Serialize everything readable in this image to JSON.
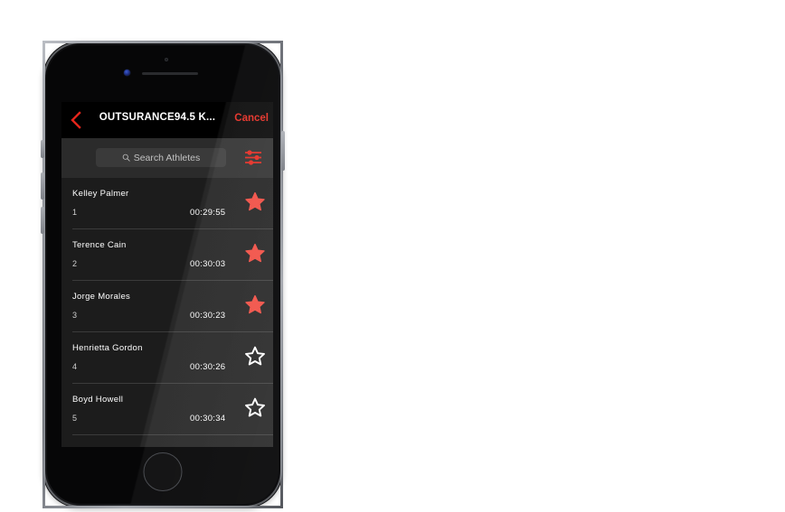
{
  "device": {
    "type": "smartphone",
    "hardware": {
      "earpiece": "earpiece-speaker",
      "camera": "front-camera",
      "sensor": "proximity-sensor",
      "home": "home-button",
      "power": "power-button",
      "volume_up": "volume-up-button",
      "volume_down": "volume-down-button",
      "silent_switch": "silent-switch"
    }
  },
  "colors": {
    "accent_red": "#e4251b",
    "star_filled": "#f0473c",
    "screen_bg": "#1c1c1c",
    "navbar_bg": "#000000",
    "search_bg": "#2b2b2b",
    "field_bg": "#3a3a3a",
    "separator": "#3b3b3b",
    "text_primary": "#ffffff",
    "text_secondary": "#cfcfcf"
  },
  "navbar": {
    "back_icon": "chevron-left-icon",
    "title": "OUTSURANCE94.5 K...",
    "cancel_label": "Cancel"
  },
  "search": {
    "icon": "search-icon",
    "placeholder": "Search Athletes",
    "value": "",
    "filter_icon": "filter-sliders-icon"
  },
  "list": {
    "rows": [
      {
        "name": "Kelley Palmer",
        "rank": "1",
        "time": "00:29:55",
        "star_icon": "star-filled-icon",
        "favorited": true
      },
      {
        "name": "Terence Cain",
        "rank": "2",
        "time": "00:30:03",
        "star_icon": "star-filled-icon",
        "favorited": true
      },
      {
        "name": "Jorge Morales",
        "rank": "3",
        "time": "00:30:23",
        "star_icon": "star-filled-icon",
        "favorited": true
      },
      {
        "name": "Henrietta Gordon",
        "rank": "4",
        "time": "00:30:26",
        "star_icon": "star-outline-icon",
        "favorited": false
      },
      {
        "name": "Boyd Howell",
        "rank": "5",
        "time": "00:30:34",
        "star_icon": "star-outline-icon",
        "favorited": false
      }
    ]
  }
}
